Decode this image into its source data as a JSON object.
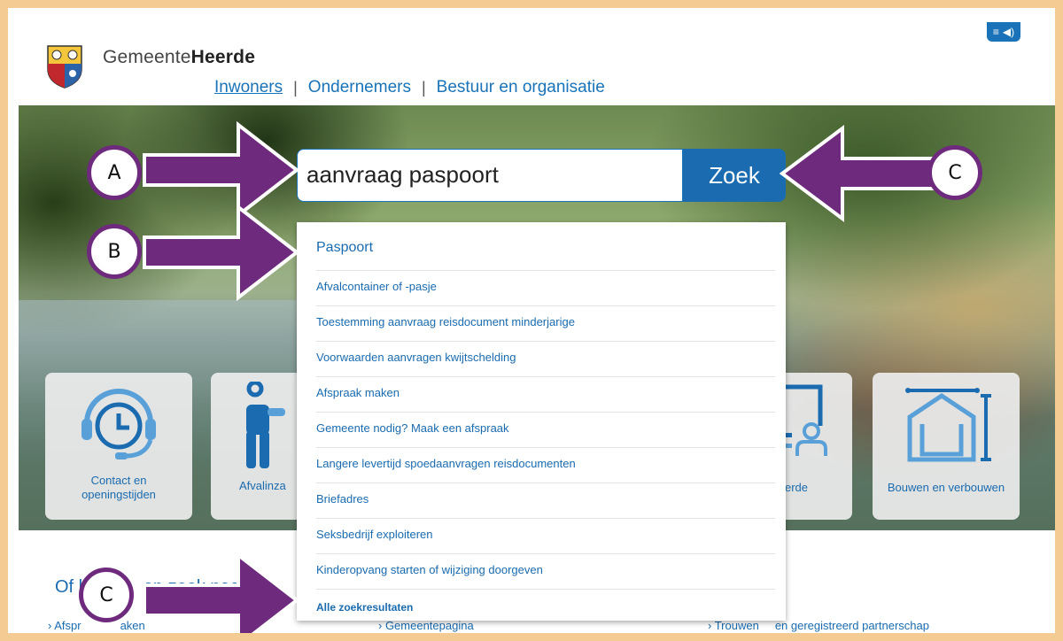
{
  "header": {
    "brand_prefix": "Gemeente",
    "brand_name": "Heerde",
    "nav": [
      "Inwoners",
      "Ondernemers",
      "Bestuur en organisatie"
    ]
  },
  "search": {
    "query": "aanvraag paspoort",
    "button_label": "Zoek"
  },
  "suggestions": [
    "Paspoort",
    "Afvalcontainer of -pasje",
    "Toestemming aanvraag reisdocument minderjarige",
    "Voorwaarden aanvragen kwijtschelding",
    "Afspraak maken",
    "Gemeente nodig? Maak een afspraak",
    "Langere levertijd spoedaanvragen reisdocumenten",
    "Briefadres",
    "Seksbedrijf exploiteren",
    "Kinderopvang starten of wijziging doorgeven",
    "Alle zoekresultaten"
  ],
  "tiles": [
    {
      "label_line1": "Contact en",
      "label_line2": "openingstijden",
      "icon": "headset-clock-icon"
    },
    {
      "label": "Afvalinza",
      "icon": "person-icon"
    },
    {
      "label": "bij Heerde",
      "icon": "person-screen-icon"
    },
    {
      "label": "Bouwen en verbouwen",
      "icon": "house-measure-icon"
    }
  ],
  "bottom": {
    "title_start": "Of b",
    "title_end": "op zoek naar",
    "links": [
      "› Afspr",
      "aken",
      "› Gemeentepagina",
      "› Trouwen",
      "en geregistreerd partnerschap"
    ]
  },
  "annotations": {
    "markers": [
      "A",
      "B",
      "C",
      "C"
    ],
    "color": "#6e2a7c"
  },
  "colors": {
    "frame": "#f5cb94",
    "link_blue": "#1a6bb0"
  }
}
